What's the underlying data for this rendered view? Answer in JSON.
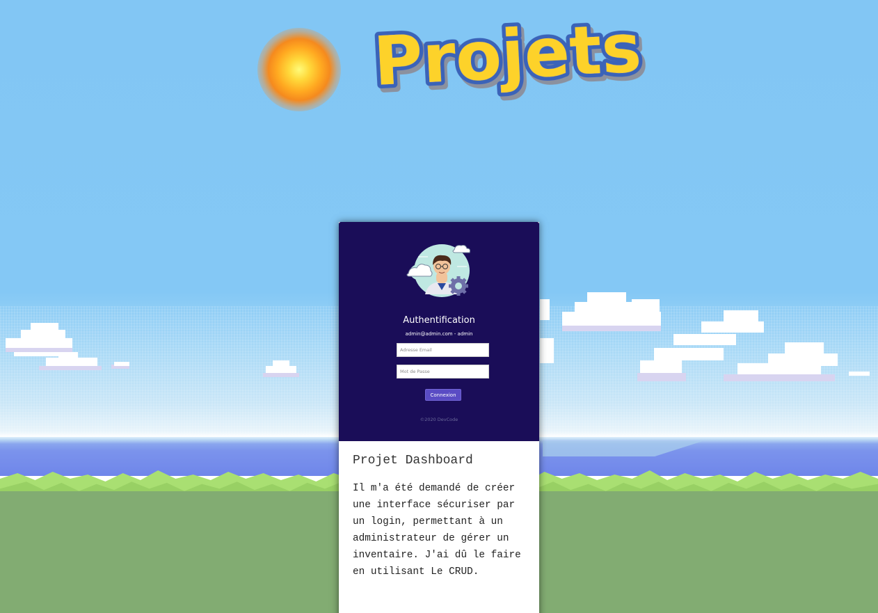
{
  "page": {
    "logo_text": "Projets"
  },
  "colors": {
    "sky": "#84c8f4",
    "sea": "#7b93ec",
    "grass": "#a9df72",
    "ground": "#82ac72",
    "panel_bg": "#1a0d58",
    "button_bg": "#5a4cc4"
  },
  "auth": {
    "title": "Authentification",
    "hint": "admin@admin.com - admin",
    "email_placeholder": "Adresse Email",
    "password_placeholder": "Mot de Passe",
    "submit_label": "Connexion",
    "copyright": "©2020 DevCode"
  },
  "project": {
    "title": "Projet Dashboard",
    "description": "Il m'a été demandé de créer une interface sécuriser par un login, permettant à un administrateur de gérer un inventaire. J'ai dû le faire en utilisant Le CRUD."
  },
  "icons": {
    "avatar": "developer-avatar-icon",
    "sun": "sun-icon",
    "gear": "gear-icon"
  }
}
